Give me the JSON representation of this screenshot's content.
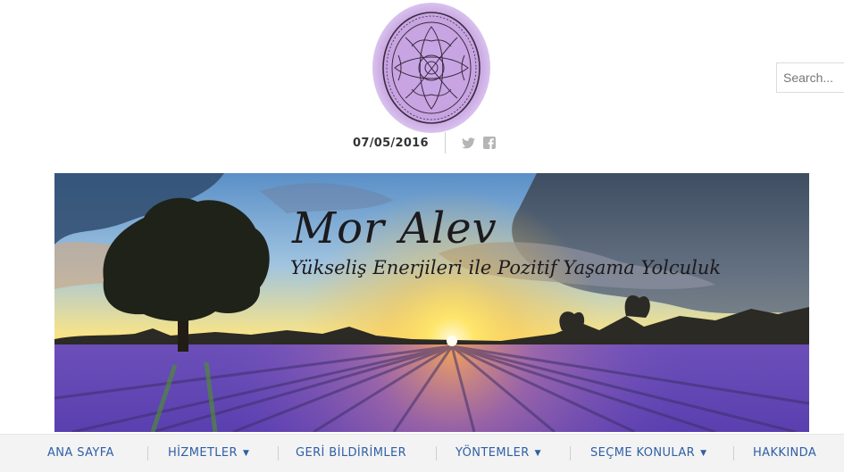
{
  "header": {
    "logo_icon": "mandala-logo-icon",
    "logo_color": "#c7a3e0",
    "search_placeholder": "Search...",
    "date": "07/05/2016",
    "social": [
      {
        "icon": "twitter-icon"
      },
      {
        "icon": "facebook-icon"
      }
    ]
  },
  "banner": {
    "title": "Mor Alev",
    "subtitle": "Yükseliş Enerjileri ile Pozitif Yaşama Yolculuk"
  },
  "nav": {
    "items": [
      {
        "label": "ANA SAYFA",
        "has_dropdown": false
      },
      {
        "label": "HİZMETLER",
        "has_dropdown": true
      },
      {
        "label": "GERİ BİLDİRİMLER",
        "has_dropdown": false
      },
      {
        "label": "YÖNTEMLER",
        "has_dropdown": true
      },
      {
        "label": "SEÇME KONULAR",
        "has_dropdown": true
      },
      {
        "label": "HAKKINDA",
        "has_dropdown": false
      }
    ],
    "caret": "▼",
    "color": "#2f5fa7"
  }
}
